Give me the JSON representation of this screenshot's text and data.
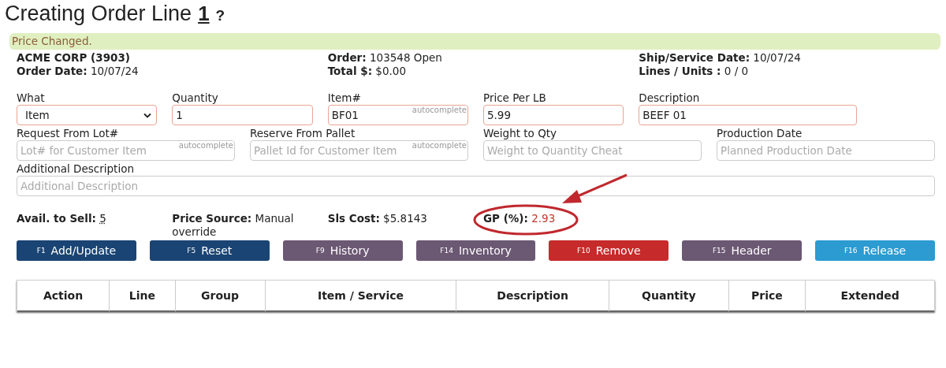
{
  "title": {
    "text": "Creating Order Line",
    "line": "1",
    "help": "?"
  },
  "alert": {
    "message": "Price Changed."
  },
  "info": [
    {
      "lines": [
        {
          "label": "ACME CORP (3903)"
        },
        {
          "label": "Order Date:",
          "value": "10/07/24"
        }
      ]
    },
    {
      "lines": [
        {
          "label": "Order:",
          "value": "103548 Open"
        },
        {
          "label": "Total $:",
          "value": "$0.00"
        }
      ]
    },
    {
      "lines": [
        {
          "label": "Ship/Service Date:",
          "value": "10/07/24"
        },
        {
          "label": "Lines / Units :",
          "value": "0 / 0"
        }
      ]
    }
  ],
  "form": {
    "fields": [
      {
        "label": "What",
        "kind": "select",
        "value": "Item",
        "required": true
      },
      {
        "label": "Quantity",
        "kind": "text",
        "value": "1",
        "required": true
      },
      {
        "label": "Item#",
        "kind": "text",
        "value": "BF01",
        "hint": "autocomplete",
        "required": true
      },
      {
        "label": "Price Per LB",
        "kind": "text",
        "value": "5.99",
        "required": true
      },
      {
        "label": "Description",
        "kind": "text",
        "value": "BEEF 01",
        "required": true
      },
      {
        "label": "Request From Lot#",
        "kind": "text",
        "placeholder": "Lot# for Customer Item",
        "hint": "autocomplete",
        "required": false
      },
      {
        "label": "Reserve From Pallet",
        "kind": "text",
        "placeholder": "Pallet Id for Customer Item",
        "hint": "autocomplete",
        "required": false
      },
      {
        "label": "Weight to Qty",
        "kind": "text",
        "placeholder": "Weight to Quantity Cheat",
        "required": false
      },
      {
        "label": "Production Date",
        "kind": "text",
        "placeholder": "Planned Production Date",
        "required": false
      },
      {
        "label": "Additional Description",
        "kind": "text",
        "placeholder": "Additional Description",
        "required": false
      }
    ]
  },
  "stats": [
    {
      "label": "Avail. to Sell:",
      "value": "5",
      "kind": "link"
    },
    {
      "label": "Price Source:",
      "value": "Manual override",
      "kind": "text"
    },
    {
      "label": "Sls Cost:",
      "value": "$5.8143",
      "kind": "text"
    },
    {
      "label": "GP (%):",
      "value": "2.93",
      "kind": "text",
      "warning": true,
      "annotation": {
        "kind": "arrow-circle"
      }
    }
  ],
  "buttons": [
    {
      "key": "F1",
      "label": "Add/Update",
      "color": "#1a4473"
    },
    {
      "key": "F5",
      "label": "Reset",
      "color": "#1a4473"
    },
    {
      "key": "F9",
      "label": "History",
      "color": "#6b5873"
    },
    {
      "key": "F14",
      "label": "Inventory",
      "color": "#6b5873"
    },
    {
      "key": "F10",
      "label": "Remove",
      "color": "#c62a2a"
    },
    {
      "key": "F15",
      "label": "Header",
      "color": "#6b5873"
    },
    {
      "key": "F16",
      "label": "Release",
      "color": "#2b9bd1"
    }
  ],
  "table": {
    "columns": [
      "Action",
      "Line",
      "Group",
      "Item / Service",
      "Description",
      "Quantity",
      "Price",
      "Extended"
    ]
  }
}
